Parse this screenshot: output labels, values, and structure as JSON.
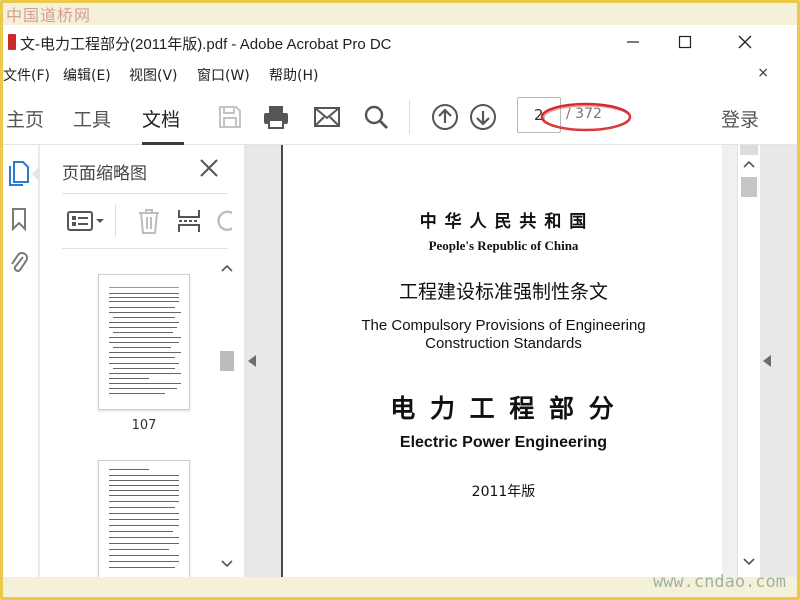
{
  "watermarks": {
    "top": "中国道桥网",
    "bottom": "www.cndao.com"
  },
  "window": {
    "title": "文-电力工程部分(2011年版).pdf - Adobe Acrobat Pro DC"
  },
  "menu": {
    "items": [
      "文件(F)",
      "编辑(E)",
      "视图(V)",
      "窗口(W)",
      "帮助(H)"
    ],
    "close_label": "×"
  },
  "toolbar": {
    "tabs": [
      "主页",
      "工具",
      "文档"
    ],
    "active_tab": "文档",
    "page_current": "2",
    "page_total": "/ 372",
    "login_label": "登录",
    "highlight_color": "#d62a2a"
  },
  "thumbnail_panel": {
    "title": "页面缩略图",
    "thumbnails": [
      {
        "label": "107"
      },
      {
        "label": ""
      }
    ]
  },
  "document_page": {
    "country_cn": "中 华 人 民 共 和 国",
    "country_en": "People's Republic of China",
    "standard_cn": "工程建设标准强制性条文",
    "standard_en_line1": "The Compulsory Provisions of Engineering",
    "standard_en_line2": "Construction Standards",
    "part_cn": "电 力 工 程 部 分",
    "part_en": "Electric Power Engineering",
    "edition": "2011年版"
  }
}
